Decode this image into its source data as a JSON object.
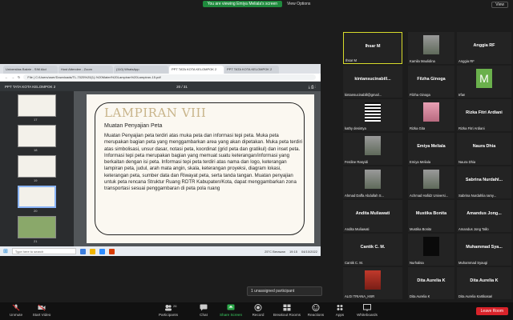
{
  "banner": {
    "sharing": "You are viewing Emiya Meliala's screen",
    "view_options": "View Options",
    "view": "View"
  },
  "browser": {
    "tabs": [
      "Universitas Bakrie - SIM Akd",
      "Host Attendee - Zoom",
      "(110) WhatsApp",
      "PPT TATA KOTA KELOMPOK 2",
      "PPT TATA KOTA KELOMPOK 2"
    ],
    "address": "File | C:/Users/user/Downloads/TL-7025%20(1)-%20Materi%20Lampiran%20Lampiran-15.pdf",
    "pdf_title": "PPT TATA KOTA KELOMPOK 2",
    "pdf_page": "20 / 31"
  },
  "thumbs": [
    "17",
    "18",
    "19",
    "20",
    "21"
  ],
  "slide": {
    "title": "LAMPIRAN VIII",
    "subtitle": "Muatan Penyajian Peta",
    "body": "Muatan Penyajian peta terdiri atas muka peta dan informasi tepi peta. Muka peta merupakan bagian peta yang menggambarkan area yang akan dipetakan. Muka peta terdiri atas simbolisasi, unsur dasar, notasi peta, koordinat (grid peta dan gratikul) dan inset peta. Informasi tepi peta merupakan bagian yang memuat suatu keterangan/informasi yang berkaitan dengan isi peta. Informasi tepi peta terdiri atas nama dan logo, keterangan lampiran peta, judul, arah mata angin, skala, keterangan proyeksi, diagram lokasi, keterangan peta, sumber data dan Riwayat peta, serta tanda tangan. Muatan penyajian untuk peta rencana Struktur Ruang RDTR Kabupaten/Kota, dapat menggambarkan zona transportasi sesuai penggambaran di peta pola ruang"
  },
  "taskbar": {
    "search": "Type here to search",
    "weather": "25°C Berawan",
    "time": "19:15",
    "date": "04/10/2022"
  },
  "participants": [
    {
      "center": "Ihsar M",
      "label": "Ihsar M",
      "active": true
    },
    {
      "center": "",
      "label": "Kamila Maulidina",
      "avatar": "photo"
    },
    {
      "center": "Anggia RF",
      "label": "Anggia RF"
    },
    {
      "center": "kintansucinabill...",
      "label": "kintansucinabill@gmail..."
    },
    {
      "center": "Filzha Ginoga",
      "label": "Filzha Ginoga"
    },
    {
      "center": "",
      "label": "Irfan",
      "avatar": "M"
    },
    {
      "center": "",
      "label": "kathy desintya",
      "avatar": "stripes"
    },
    {
      "center": "",
      "label": "Rizka Gita",
      "avatar": "pink"
    },
    {
      "center": "Rizka Fitri Ardiani",
      "label": "Rizka Fitri Ardiani"
    },
    {
      "center": "",
      "label": "Ferdine Rasyidi",
      "avatar": "photo"
    },
    {
      "center": "Emiya Meliala",
      "label": "Emiya Meliala"
    },
    {
      "center": "Naura Dhia",
      "label": "Naura Dhia"
    },
    {
      "center": "",
      "label": "Ahmad Daffa Abdullah S...",
      "avatar": "photo"
    },
    {
      "center": "",
      "label": "Achmad Hafidz Universi...",
      "avatar": "photo"
    },
    {
      "center": "Sabrina Nurdahl...",
      "label": "Sabrina Nurdahlia ramy..."
    },
    {
      "center": "Andita Muliawati",
      "label": "Andita Muliawati"
    },
    {
      "center": "Mustika Bonita",
      "label": "Mustika Bonita"
    },
    {
      "center": "Amandus Jong...",
      "label": "Amandus Jong Tallo"
    },
    {
      "center": "Cantik C. M.",
      "label": "Cantik C. M."
    },
    {
      "center": "",
      "label": "Nurhalisa",
      "avatar": "dark"
    },
    {
      "center": "Muhammad Sya...",
      "label": "Muhammad Syaugi"
    },
    {
      "center": "",
      "label": "ALGI TRIANA_HSR",
      "avatar": "red"
    },
    {
      "center": "Dita Aurelia K",
      "label": "Dita Aurelia K"
    },
    {
      "center": "Dita Aurelia K",
      "label": "Dita Aurelia Kartikasari"
    }
  ],
  "unassigned": "1 unassigned participant",
  "toolbar": {
    "unmute": "Unmute",
    "video": "Start Video",
    "participants": "Participants",
    "participants_count": "26",
    "chat": "Chat",
    "share": "Share Screen",
    "record": "Record",
    "breakout": "Breakout Rooms",
    "reactions": "Reactions",
    "apps": "Apps",
    "whiteboards": "Whiteboards",
    "leave": "Leave Room"
  }
}
